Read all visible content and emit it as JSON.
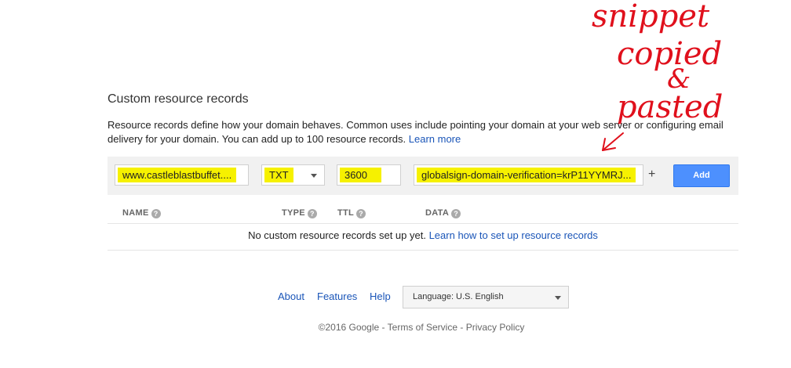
{
  "section": {
    "title": "Custom resource records",
    "description": "Resource records define how your domain behaves. Common uses include pointing your domain at your web server or configuring email delivery for your domain. You can add up to 100 resource records.",
    "learn_more": "Learn more"
  },
  "form": {
    "name_value": "www.castleblastbuffet....",
    "type_value": "TXT",
    "ttl_value": "3600",
    "data_value": "globalsign-domain-verification=krP11YYMRJ...",
    "plus": "+",
    "add_label": "Add",
    "highlight_color": "#f6f100"
  },
  "table": {
    "columns": [
      "NAME",
      "TYPE",
      "TTL",
      "DATA"
    ],
    "help_glyph": "?",
    "empty_text": "No custom resource records set up yet.",
    "empty_link": "Learn how to set up resource records"
  },
  "footer": {
    "links": [
      "About",
      "Features",
      "Help"
    ],
    "language": "Language: U.S. English",
    "copyright": "©2016 Google",
    "terms": "Terms of Service",
    "privacy": "Privacy Policy",
    "separator": " - "
  },
  "annotation": {
    "lines": [
      "snippet",
      "copied",
      "&",
      "pasted"
    ],
    "color": "#e0101c"
  }
}
